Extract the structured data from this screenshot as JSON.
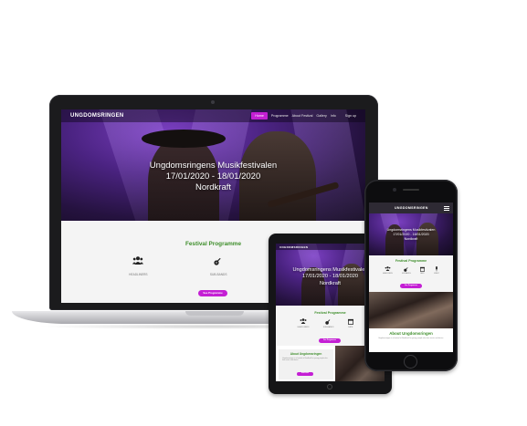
{
  "site": {
    "logo": "UNGDOMSRINGEN",
    "nav": [
      "Home",
      "Programme",
      "About Festival",
      "Gallery",
      "Info",
      "Sign up"
    ],
    "nav_active": "Home",
    "hero": {
      "title": "Ungdomsringens Musikfestivalen",
      "dates": "17/01/2020 - 18/01/2020",
      "venue": "Nordkraft"
    },
    "programme": {
      "title": "Festival Programme",
      "items": [
        "HEADLINERS",
        "SUB-BANDS",
        "DATE",
        "LINEUP"
      ],
      "button": "See Programme"
    },
    "about": {
      "title": "About Ungdomsringen",
      "text": "Ungdomsringen is a festival at Nordkraft for young people who love music and dance.",
      "button": "Read more"
    }
  },
  "colors": {
    "accent": "#c41fd4",
    "section_title": "#3e8e2b",
    "hero_dark": "#25123f",
    "hero_light": "#7a3fc0",
    "device_dark": "#1b1b1d"
  },
  "icons": [
    "users-icon",
    "guitar-icon",
    "calendar-icon",
    "microphone-icon",
    "menu-icon"
  ]
}
